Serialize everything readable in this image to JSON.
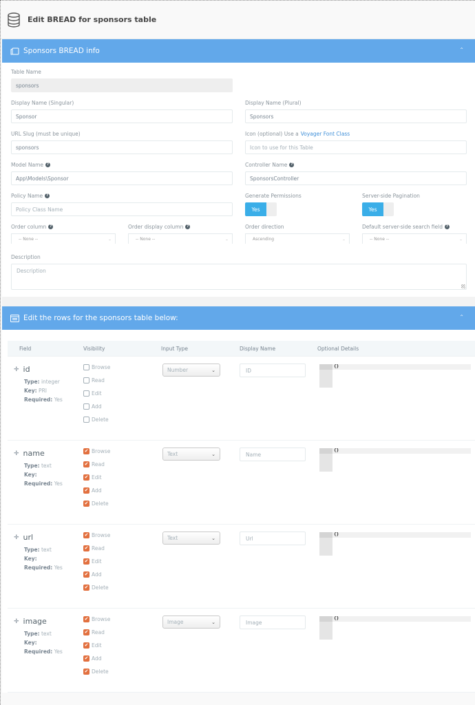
{
  "header": {
    "title": "Edit BREAD for sponsors table",
    "icon": "database-icon"
  },
  "info_panel": {
    "title": "Sponsors BREAD info",
    "icon": "book-icon",
    "collapse_icon": "chevron-up-icon",
    "table_name": {
      "label": "Table Name",
      "value": "sponsors"
    },
    "display_singular": {
      "label": "Display Name (Singular)",
      "value": "Sponsor"
    },
    "display_plural": {
      "label": "Display Name (Plural)",
      "value": "Sponsors"
    },
    "url_slug": {
      "label": "URL Slug (must be unique)",
      "value": "sponsors"
    },
    "icon_field": {
      "label": "Icon (optional) Use a",
      "link": "Voyager Font Class",
      "placeholder": "Icon to use for this Table"
    },
    "model_name": {
      "label": "Model Name",
      "value": "App\\Models\\Sponsor"
    },
    "controller_name": {
      "label": "Controller Name",
      "value": "SponsorsController"
    },
    "policy_name": {
      "label": "Policy Name",
      "placeholder": "Policy Class Name"
    },
    "generate_permissions": {
      "label": "Generate Permissions",
      "value": "Yes"
    },
    "server_pagination": {
      "label": "Server-side Pagination",
      "value": "Yes"
    },
    "order_column": {
      "label": "Order column",
      "value": "-- None --"
    },
    "order_display_column": {
      "label": "Order display column",
      "value": "-- None --"
    },
    "order_direction": {
      "label": "Order direction",
      "value": "Ascending"
    },
    "default_search": {
      "label": "Default server-side search field",
      "value": "-- None --"
    },
    "description": {
      "label": "Description",
      "placeholder": "Description"
    }
  },
  "rows_panel": {
    "title": "Edit the rows for the sponsors table below:",
    "icon": "window-list-icon",
    "collapse_icon": "chevron-up-icon",
    "columns": [
      "Field",
      "Visibility",
      "Input Type",
      "Display Name",
      "Optional Details"
    ],
    "meta_labels": {
      "type": "Type:",
      "key": "Key:",
      "required": "Required:"
    },
    "visibility_labels": [
      "Browse",
      "Read",
      "Edit",
      "Add",
      "Delete"
    ],
    "rows": [
      {
        "name": "id",
        "type": "integer",
        "key": "PRI",
        "required": "Yes",
        "visibility": [
          false,
          false,
          false,
          false,
          false
        ],
        "input_type": "Number",
        "display_name": "ID",
        "details": "{}"
      },
      {
        "name": "name",
        "type": "text",
        "key": "",
        "required": "Yes",
        "visibility": [
          true,
          true,
          true,
          true,
          true
        ],
        "input_type": "Text",
        "display_name": "Name",
        "details": "{}"
      },
      {
        "name": "url",
        "type": "text",
        "key": "",
        "required": "Yes",
        "visibility": [
          true,
          true,
          true,
          true,
          true
        ],
        "input_type": "Text",
        "display_name": "Url",
        "details": "{}"
      },
      {
        "name": "image",
        "type": "text",
        "key": "",
        "required": "Yes",
        "visibility": [
          true,
          true,
          true,
          true,
          true
        ],
        "input_type": "Image",
        "display_name": "Image",
        "details": "{}"
      }
    ]
  }
}
